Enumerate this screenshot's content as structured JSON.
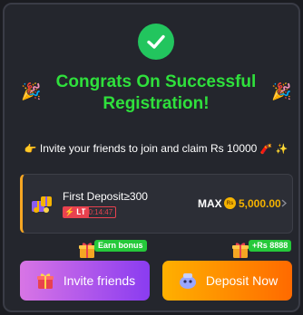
{
  "modal": {
    "title_line1": "Congrats On Successful",
    "title_line2": "Registration!",
    "invite_message": "Invite your friends to join and claim Rs 10000"
  },
  "first_deposit": {
    "title": "First Deposit≥300",
    "badge": "LT",
    "timer": "00:14:47",
    "max_label": "MAX",
    "currency_symbol": "Rs",
    "amount": "5,000.00"
  },
  "actions": {
    "invite_badge": "Earn bonus",
    "invite_label": "Invite friends",
    "deposit_badge": "+Rs 8888",
    "deposit_label": "Deposit Now"
  },
  "colors": {
    "success_green": "#2fe03c",
    "accent_orange": "#f5a623",
    "amount_gold": "#f5b300",
    "timer_red": "#e8424f",
    "invite_gradient": [
      "#d875e5",
      "#8a3cf0"
    ],
    "deposit_gradient": [
      "#ffb000",
      "#ff6a00"
    ]
  },
  "icons": {
    "status": "check-circle-icon",
    "decor": "party-popper-icon",
    "message_prefix": "pointing-hand-icon",
    "message_suffix": "sparkles-icon"
  }
}
